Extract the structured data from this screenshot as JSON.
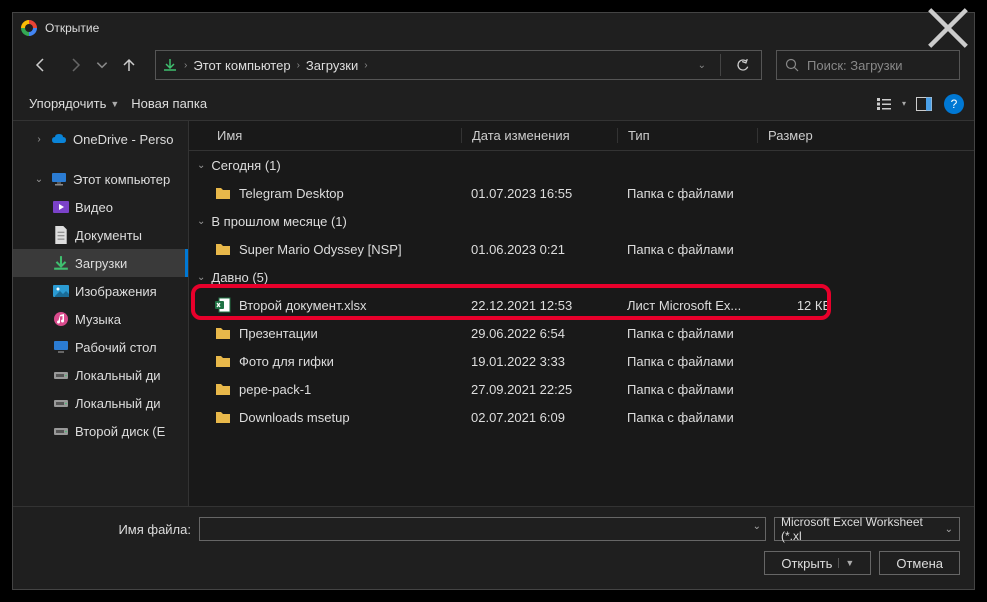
{
  "title": "Открытие",
  "breadcrumb": {
    "seg1": "Этот компьютер",
    "seg2": "Загрузки"
  },
  "search": {
    "placeholder": "Поиск: Загрузки"
  },
  "toolbar": {
    "organize": "Упорядочить",
    "new_folder": "Новая папка"
  },
  "sidebar": {
    "onedrive": "OneDrive - Perso",
    "this_pc": "Этот компьютер",
    "video": "Видео",
    "documents": "Документы",
    "downloads": "Загрузки",
    "images": "Изображения",
    "music": "Музыка",
    "desktop": "Рабочий стол",
    "local_disk1": "Локальный ди",
    "local_disk2": "Локальный ди",
    "second_disk": "Второй диск (E"
  },
  "columns": {
    "name": "Имя",
    "date": "Дата изменения",
    "type": "Тип",
    "size": "Размер"
  },
  "groups": {
    "today": "Сегодня (1)",
    "last_month": "В прошлом месяце (1)",
    "long_ago": "Давно (5)"
  },
  "files": {
    "telegram": {
      "name": "Telegram Desktop",
      "date": "01.07.2023 16:55",
      "type": "Папка с файлами",
      "size": ""
    },
    "mario": {
      "name": "Super Mario Odyssey [NSP]",
      "date": "01.06.2023 0:21",
      "type": "Папка с файлами",
      "size": ""
    },
    "doc2": {
      "name": "Второй документ.xlsx",
      "date": "22.12.2021 12:53",
      "type": "Лист Microsoft Ex...",
      "size": "12 КБ"
    },
    "present": {
      "name": "Презентации",
      "date": "29.06.2022 6:54",
      "type": "Папка с файлами",
      "size": ""
    },
    "gif": {
      "name": "Фото для гифки",
      "date": "19.01.2022 3:33",
      "type": "Папка с файлами",
      "size": ""
    },
    "pepe": {
      "name": "pepe-pack-1",
      "date": "27.09.2021 22:25",
      "type": "Папка с файлами",
      "size": ""
    },
    "dlmsetup": {
      "name": "Downloads msetup",
      "date": "02.07.2021 6:09",
      "type": "Папка с файлами",
      "size": ""
    }
  },
  "footer": {
    "filename_label": "Имя файла:",
    "filter": "Microsoft Excel Worksheet (*.xl",
    "open": "Открыть",
    "cancel": "Отмена"
  }
}
